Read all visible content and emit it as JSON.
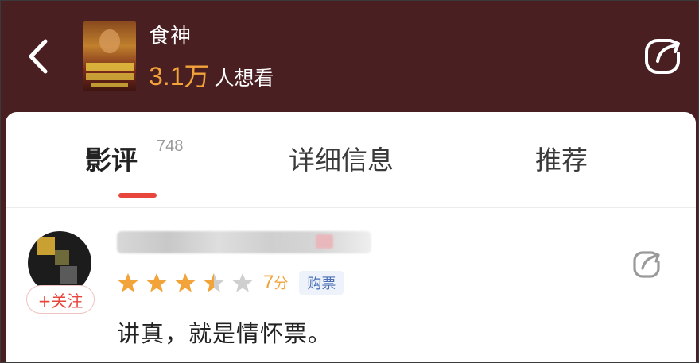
{
  "header": {
    "title": "食神",
    "want_count": "3.1万",
    "want_suffix": "人想看"
  },
  "tabs": [
    {
      "label": "影评",
      "count": "748",
      "active": true
    },
    {
      "label": "详细信息",
      "active": false
    },
    {
      "label": "推荐",
      "active": false
    }
  ],
  "review": {
    "follow_label": "+关注",
    "rating_stars": 3.5,
    "rating_max": 5,
    "score": "7",
    "score_unit": "分",
    "badge": "购票",
    "text": "讲真，就是情怀票。"
  },
  "colors": {
    "header_bg": "#4a1f22",
    "accent_red": "#e8453c",
    "star_gold": "#f2a33a",
    "star_gray": "#cfcfcf"
  },
  "icons": [
    "back-arrow-icon",
    "share-icon",
    "star-icon"
  ]
}
